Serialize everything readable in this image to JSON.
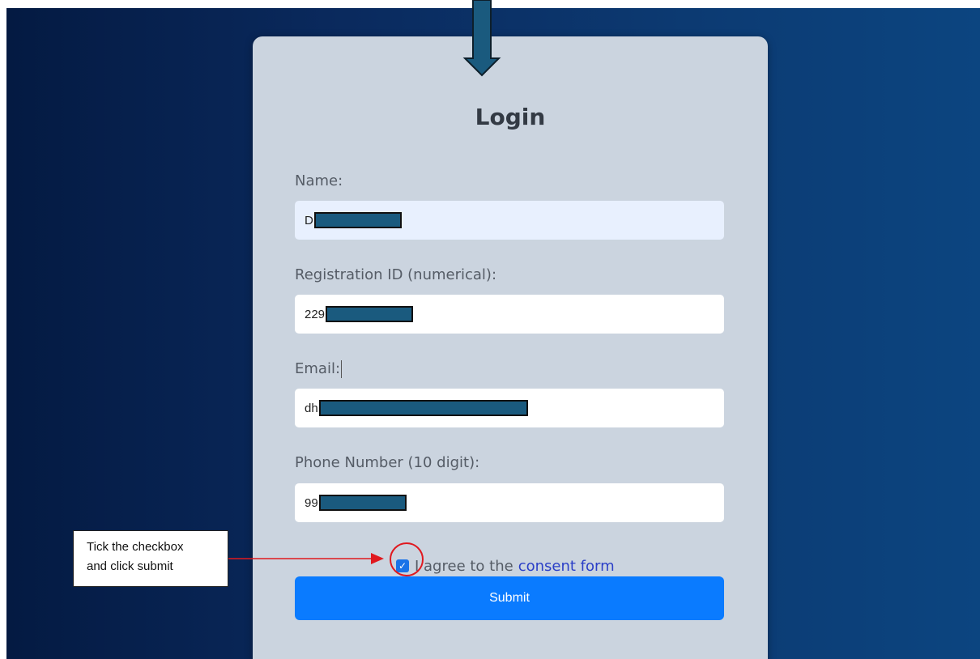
{
  "form": {
    "title": "Login",
    "fields": [
      {
        "label": "Name:",
        "value": "D"
      },
      {
        "label": "Registration ID (numerical):",
        "value": "229"
      },
      {
        "label": "Email:",
        "value": "dh"
      },
      {
        "label": "Phone Number (10 digit):",
        "value": "99"
      }
    ],
    "consent": {
      "checked": true,
      "prefix": "I agree to the",
      "link_text": "consent form"
    },
    "submit_label": "Submit"
  },
  "annotation": {
    "note_line1": "Tick the checkbox",
    "note_line2": "and click submit"
  },
  "colors": {
    "background_start": "#041a42",
    "background_end": "#0c4580",
    "card": "#cbd4df",
    "submit": "#0a7bff",
    "link": "#2b3fc7",
    "redaction": "#1a5a7e",
    "annotation_red": "#e0191f",
    "arrow": "#1a5a7e"
  }
}
